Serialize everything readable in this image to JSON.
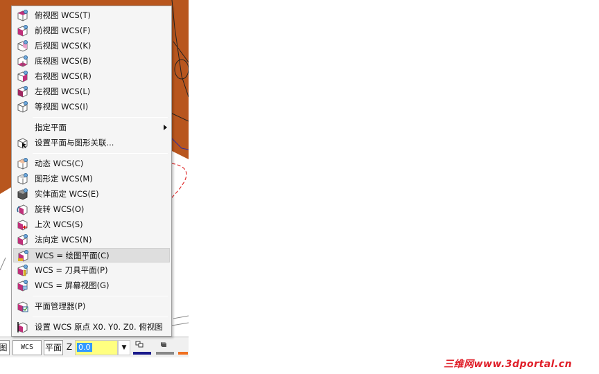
{
  "menu": {
    "items": [
      {
        "label": "俯视图 WCS(T)",
        "icon": "view-top-icon"
      },
      {
        "label": "前视图 WCS(F)",
        "icon": "view-front-icon"
      },
      {
        "label": "后视图 WCS(K)",
        "icon": "view-back-icon"
      },
      {
        "label": "底视图 WCS(B)",
        "icon": "view-bottom-icon"
      },
      {
        "label": "右视图 WCS(R)",
        "icon": "view-right-icon"
      },
      {
        "label": "左视图 WCS(L)",
        "icon": "view-left-icon"
      },
      {
        "label": "等视图 WCS(I)",
        "icon": "view-iso-icon"
      },
      {
        "label": "指定平面",
        "icon": "",
        "submenu": true
      },
      {
        "label": "设置平面与图形关联...",
        "icon": "plane-associate-icon"
      },
      {
        "label": "动态 WCS(C)",
        "icon": "dynamic-wcs-icon"
      },
      {
        "label": "图形定 WCS(M)",
        "icon": "geometry-wcs-icon"
      },
      {
        "label": "实体面定 WCS(E)",
        "icon": "solid-face-wcs-icon"
      },
      {
        "label": "旋转 WCS(O)",
        "icon": "rotate-wcs-icon"
      },
      {
        "label": "上次 WCS(S)",
        "icon": "last-wcs-icon"
      },
      {
        "label": "法向定 WCS(N)",
        "icon": "normal-wcs-icon"
      },
      {
        "label": "WCS = 绘图平面(C)",
        "icon": "wcs-cplane-icon",
        "highlighted": true
      },
      {
        "label": "WCS = 刀具平面(P)",
        "icon": "wcs-tplane-icon"
      },
      {
        "label": "WCS = 屏幕视图(G)",
        "icon": "wcs-gview-icon"
      },
      {
        "label": "平面管理器(P)",
        "icon": "plane-manager-icon"
      },
      {
        "label": "设置 WCS 原点 X0. Y0. Z0.  俯视图",
        "icon": "wcs-origin-icon"
      }
    ]
  },
  "statusbar": {
    "left_fragment": "图",
    "wcs_label": "WCS",
    "plane_label": "平面",
    "z_label": "Z",
    "z_value": "0.0",
    "dropdown_arrow": "▼",
    "color_bars": [
      "#1a1a8c",
      "#888888",
      "#808080",
      "#f07020"
    ]
  },
  "watermark": "三维网www.3dportal.cn",
  "colors": {
    "model_fill": "#b8561e",
    "menu_bg": "#f5f5f5",
    "highlight": "#dedede",
    "icon_magenta": "#c0307a"
  }
}
